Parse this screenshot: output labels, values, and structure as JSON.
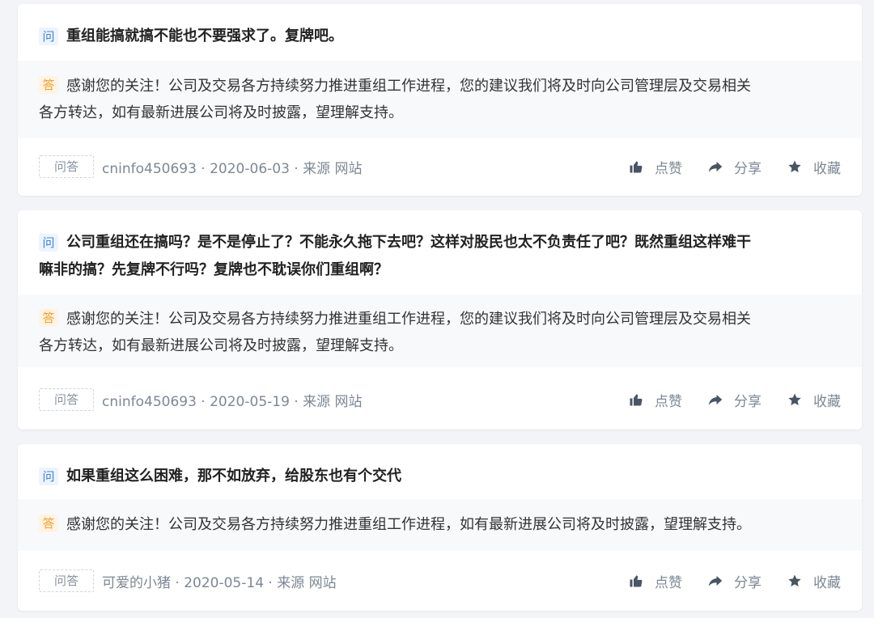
{
  "tag_label": "问答",
  "question_badge": "问",
  "answer_badge": "答",
  "actions": {
    "like": "点赞",
    "share": "分享",
    "favorite": "收藏"
  },
  "items": [
    {
      "question": "重组能搞就搞不能也不要强求了。复牌吧。",
      "answer_lines": [
        "感谢您的关注！公司及交易各方持续努力推进重组工作进程，您的建议我们将及时向公司管理层及交易相关",
        "各方转达，如有最新进展公司将及时披露，望理解支持。"
      ],
      "meta": "cninfo450693 · 2020-06-03 · 来源 网站"
    },
    {
      "question_lines": [
        "公司重组还在搞吗？是不是停止了？不能永久拖下去吧？这样对股民也太不负责任了吧？既然重组这样难干",
        "嘛非的搞？先复牌不行吗？复牌也不耽误你们重组啊？"
      ],
      "answer_lines": [
        "感谢您的关注！公司及交易各方持续努力推进重组工作进程，您的建议我们将及时向公司管理层及交易相关",
        "各方转达，如有最新进展公司将及时披露，望理解支持。"
      ],
      "meta": "cninfo450693 · 2020-05-19 · 来源 网站"
    },
    {
      "question": "如果重组这么困难，那不如放弃，给股东也有个交代",
      "answer_lines": [
        "感谢您的关注！公司及交易各方持续努力推进重组工作进程，如有最新进展公司将及时披露，望理解支持。"
      ],
      "meta": "可爱的小猪 · 2020-05-14 · 来源 网站"
    }
  ],
  "colors": {
    "question_badge": "#3d7fe0",
    "answer_badge": "#f5a02a",
    "icon": "#4a5564",
    "meta_text": "#7d8794"
  },
  "icons": [
    "thumbs-up-icon",
    "share-arrow-icon",
    "star-icon"
  ]
}
